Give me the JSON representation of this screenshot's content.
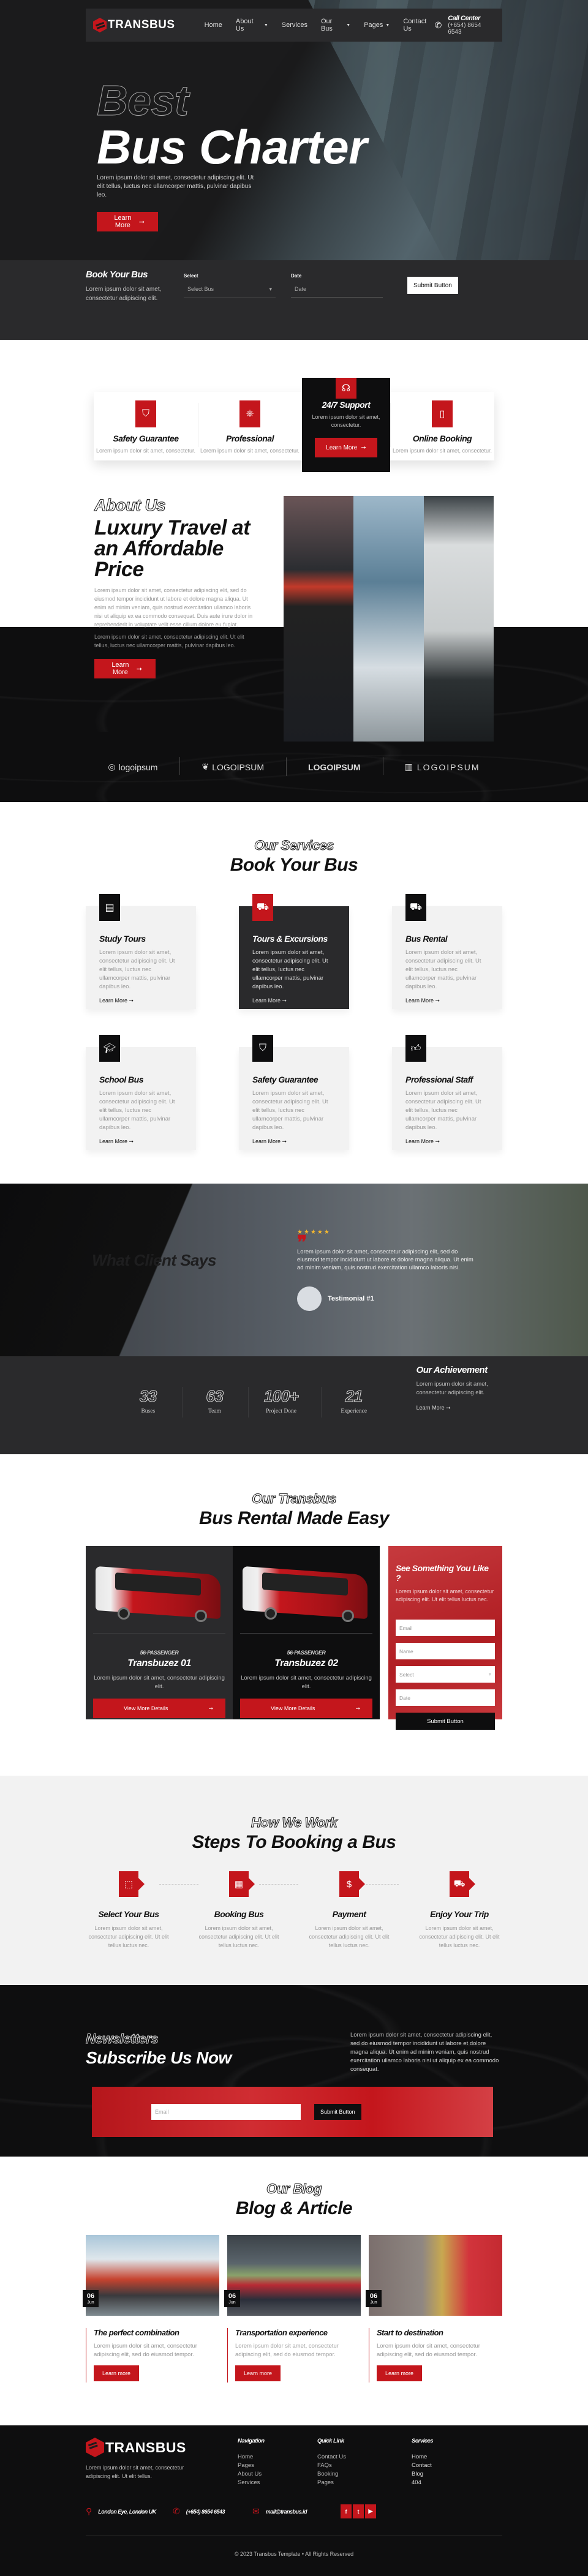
{
  "brand": {
    "name": "TRANSBUS",
    "accent": "#c4161c",
    "dark": "#0e0e0f",
    "panel": "#2a2a2c"
  },
  "nav": {
    "items": [
      {
        "label": "Home",
        "dropdown": false
      },
      {
        "label": "About Us",
        "dropdown": true
      },
      {
        "label": "Services",
        "dropdown": false
      },
      {
        "label": "Our Bus",
        "dropdown": true
      },
      {
        "label": "Pages",
        "dropdown": true
      },
      {
        "label": "Contact Us",
        "dropdown": false
      }
    ],
    "call_label": "Call Center",
    "call_number": "(+654) 8654 6543"
  },
  "hero": {
    "kicker": "Best",
    "title": "Bus Charter",
    "description": "Lorem ipsum dolor sit amet, consectetur adipiscing elit. Ut elit tellus, luctus nec ullamcorper mattis, pulvinar dapibus leo.",
    "button": "Learn More"
  },
  "booking": {
    "title": "Book Your Bus",
    "description": "Lorem ipsum dolor sit amet, consectetur adipiscing elit.",
    "select_label": "Select",
    "select_value": "Select Bus",
    "date_label": "Date",
    "date_placeholder": "Date",
    "submit": "Submit Button"
  },
  "features": [
    {
      "icon": "shield-check",
      "title": "Safety Guarantee",
      "desc": "Lorem ipsum dolor sit amet, consectetur."
    },
    {
      "icon": "steering-wheel",
      "title": "Professional",
      "desc": "Lorem ipsum dolor sit amet, consectetur."
    },
    {
      "icon": "headset",
      "title": "24/7 Support",
      "desc": "Lorem ipsum dolor sit amet, consectetur.",
      "button": "Learn More"
    },
    {
      "icon": "phone-ticket",
      "title": "Online Booking",
      "desc": "Lorem ipsum dolor sit amet, consectetur."
    }
  ],
  "about": {
    "kicker": "About Us",
    "title": "Luxury Travel at an Affordable Price",
    "p1": "Lorem ipsum dolor sit amet, consectetur adipiscing elit, sed do eiusmod tempor incididunt ut labore et dolore magna aliqua. Ut enim ad minim veniam, quis nostrud exercitation ullamco laboris nisi ut aliquip ex ea commodo consequat. Duis aute irure dolor in reprehenderit in voluptate velit esse cillum dolore eu fugiat.",
    "p2": "Lorem ipsum dolor sit amet, consectetur adipiscing elit. Ut elit tellus, luctus nec ullamcorper mattis, pulvinar dapibus leo.",
    "button": "Learn More"
  },
  "partners": [
    "logoipsum",
    "LOGOIPSUM",
    "LOGOIPSUM",
    "LOGOIPSUM"
  ],
  "services": {
    "kicker": "Our Services",
    "title": "Book Your Bus",
    "items": [
      {
        "icon": "book",
        "title": "Study Tours",
        "desc": "Lorem ipsum dolor sit amet, consectetur adipiscing elit. Ut elit tellus, luctus nec ullamcorper mattis, pulvinar dapibus leo.",
        "link": "Learn More"
      },
      {
        "icon": "bus-front",
        "title": "Tours & Excursions",
        "desc": "Lorem ipsum dolor sit amet, consectetur adipiscing elit. Ut elit tellus, luctus nec ullamcorper mattis, pulvinar dapibus leo.",
        "link": "Learn More"
      },
      {
        "icon": "bus",
        "title": "Bus Rental",
        "desc": "Lorem ipsum dolor sit amet, consectetur adipiscing elit. Ut elit tellus, luctus nec ullamcorper mattis, pulvinar dapibus leo.",
        "link": "Learn More"
      },
      {
        "icon": "graduation-cap",
        "title": "School Bus",
        "desc": "Lorem ipsum dolor sit amet, consectetur adipiscing elit. Ut elit tellus, luctus nec ullamcorper mattis, pulvinar dapibus leo.",
        "link": "Learn More"
      },
      {
        "icon": "shield-check",
        "title": "Safety Guarantee",
        "desc": "Lorem ipsum dolor sit amet, consectetur adipiscing elit. Ut elit tellus, luctus nec ullamcorper mattis, pulvinar dapibus leo.",
        "link": "Learn More"
      },
      {
        "icon": "thumbs-up",
        "title": "Professional Staff",
        "desc": "Lorem ipsum dolor sit amet, consectetur adipiscing elit. Ut elit tellus, luctus nec ullamcorper mattis, pulvinar dapibus leo.",
        "link": "Learn More"
      }
    ]
  },
  "testimonial": {
    "heading": "What Client Says",
    "rating": 5,
    "max_rating": 5,
    "quote": "Lorem ipsum dolor sit amet, consectetur adipiscing elit, sed do eiusmod tempor incididunt ut labore et dolore magna aliqua. Ut enim ad minim veniam, quis nostrud exercitation ullamco laboris nisi.",
    "name": "Testimonial #1"
  },
  "stats": {
    "items": [
      {
        "value": "33",
        "label": "Buses"
      },
      {
        "value": "63",
        "label": "Team"
      },
      {
        "value": "100+",
        "label": "Project Done"
      },
      {
        "value": "21",
        "label": "Experience"
      }
    ],
    "achievement_title": "Our Achievement",
    "achievement_desc": "Lorem ipsum dolor sit amet, consectetur adipiscing elit.",
    "link": "Learn More"
  },
  "fleet": {
    "kicker": "Our Transbus",
    "title": "Bus Rental Made Easy",
    "buses": [
      {
        "capacity": "56-PASSENGER",
        "name": "Transbuzez 01",
        "desc": "Lorem ipsum dolor sit amet, consectetur adipiscing elit.",
        "button": "View More Details"
      },
      {
        "capacity": "56-PASSENGER",
        "name": "Transbuzez 02",
        "desc": "Lorem ipsum dolor sit amet, consectetur adipiscing elit.",
        "button": "View More Details"
      }
    ],
    "form": {
      "title": "See Something You Like ?",
      "desc": "Lorem ipsum dolor sit amet, consectetur adipiscing elit. Ut elit tellus luctus nec.",
      "email_placeholder": "Email",
      "name_placeholder": "Name",
      "select_value": "Select",
      "date_placeholder": "Date",
      "submit": "Submit Button"
    }
  },
  "steps": {
    "kicker": "How We Work",
    "title": "Steps To Booking a Bus",
    "items": [
      {
        "icon": "cursor-click",
        "title": "Select Your Bus",
        "desc": "Lorem ipsum dolor sit amet, consectetur adipiscing elit. Ut elit tellus luctus nec."
      },
      {
        "icon": "calendar",
        "title": "Booking Bus",
        "desc": "Lorem ipsum dolor sit amet, consectetur adipiscing elit. Ut elit tellus luctus nec."
      },
      {
        "icon": "invoice-dollar",
        "title": "Payment",
        "desc": "Lorem ipsum dolor sit amet, consectetur adipiscing elit. Ut elit tellus luctus nec."
      },
      {
        "icon": "bus-front",
        "title": "Enjoy Your Trip",
        "desc": "Lorem ipsum dolor sit amet, consectetur adipiscing elit. Ut elit tellus luctus nec."
      }
    ]
  },
  "newsletter": {
    "kicker": "Newsletters",
    "title": "Subscribe Us Now",
    "desc": "Lorem ipsum dolor sit amet, consectetur adipiscing elit, sed do eiusmod tempor incididunt ut labore et dolore magna aliqua. Ut enim ad minim veniam, quis nostrud exercitation ullamco laboris nisi ut aliquip ex ea commodo consequat.",
    "email_placeholder": "Email",
    "submit": "Submit Button"
  },
  "blog": {
    "kicker": "Our Blog",
    "title": "Blog & Article",
    "posts": [
      {
        "day": "06",
        "month": "Jun",
        "title": "The perfect combination",
        "desc": "Lorem ipsum dolor sit amet, consectetur adipiscing elit, sed do eiusmod tempor.",
        "button": "Learn more"
      },
      {
        "day": "06",
        "month": "Jun",
        "title": "Transportation experience",
        "desc": "Lorem ipsum dolor sit amet, consectetur adipiscing elit, sed do eiusmod tempor.",
        "button": "Learn more"
      },
      {
        "day": "06",
        "month": "Jun",
        "title": "Start to destination",
        "desc": "Lorem ipsum dolor sit amet, consectetur adipiscing elit, sed do eiusmod tempor.",
        "button": "Learn more"
      }
    ]
  },
  "footer": {
    "desc": "Lorem ipsum dolor sit amet, consectetur adipiscing elit. Ut elit tellus.",
    "columns": [
      {
        "heading": "Navigation",
        "links": [
          "Home",
          "Pages",
          "About Us",
          "Services"
        ]
      },
      {
        "heading": "Quick Link",
        "links": [
          "Contact Us",
          "FAQs",
          "Booking",
          "Pages"
        ]
      },
      {
        "heading": "Services",
        "links": [
          "Home",
          "Contact",
          "Blog",
          "404"
        ]
      }
    ],
    "address": "London Eye, London UK",
    "phone": "(+654) 8654 6543",
    "email": "mail@transbus.id",
    "social": [
      "facebook",
      "twitter",
      "youtube"
    ],
    "copyright": "© 2023 Transbus Template • All Rights Reserved"
  }
}
